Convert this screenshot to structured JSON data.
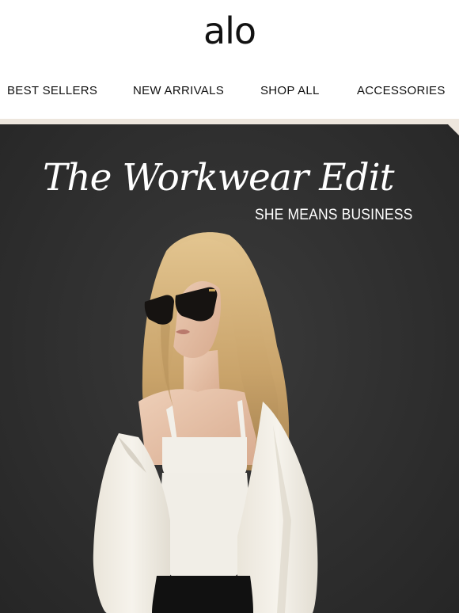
{
  "brand": {
    "logo_text": "alo"
  },
  "nav": {
    "items": [
      {
        "label": "BEST SELLERS"
      },
      {
        "label": "NEW ARRIVALS"
      },
      {
        "label": "SHOP ALL"
      },
      {
        "label": "ACCESSORIES"
      }
    ]
  },
  "hero": {
    "title": "The Workwear Edit",
    "subtitle": "SHE MEANS BUSINESS",
    "background_color": "#2f2f2f",
    "accent_color": "#ede6dd"
  }
}
